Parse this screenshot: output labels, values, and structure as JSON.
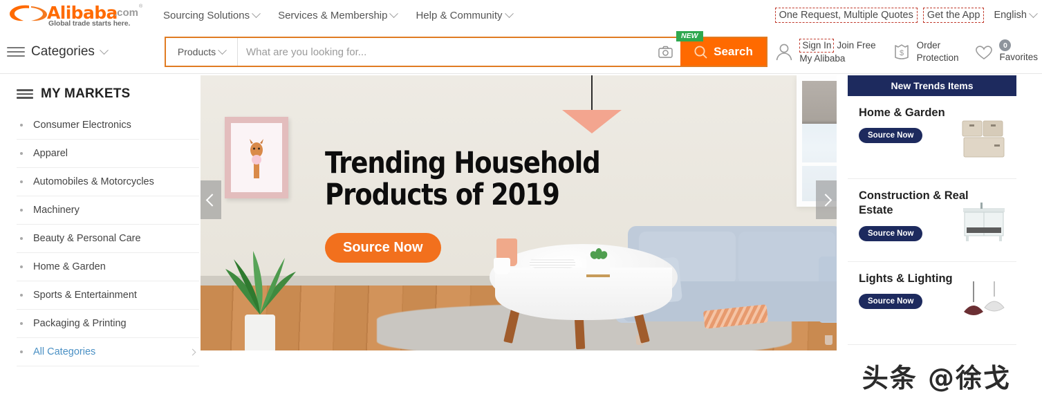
{
  "brand": {
    "logo_word": "Alibaba",
    "logo_dotcom": ".com",
    "logo_reg": "®",
    "tagline": "Global trade starts here.",
    "accent_orange": "#ff6a00",
    "navy": "#1d2a5e",
    "cta_orange": "#f2701d",
    "annotation_red": "#c0392b"
  },
  "topnav": {
    "items": [
      {
        "label": "Sourcing Solutions"
      },
      {
        "label": "Services & Membership"
      },
      {
        "label": "Help & Community"
      }
    ],
    "one_request": "One Request, Multiple Quotes",
    "get_the_app": "Get the App",
    "language": "English"
  },
  "search": {
    "categories_label": "Categories",
    "type_selector": "Products",
    "placeholder": "What are you looking for...",
    "button_label": "Search",
    "new_badge": "NEW",
    "camera_icon": "camera-icon",
    "search_icon": "magnifier-icon"
  },
  "user": {
    "sign_in": "Sign In",
    "join_free": "Join Free",
    "my_alibaba": "My Alibaba",
    "order_protection_line1": "Order",
    "order_protection_line2": "Protection",
    "favorites_label": "Favorites",
    "favorites_count": "0",
    "person_icon": "person-icon",
    "shield_icon": "order-protection-icon",
    "heart_icon": "heart-icon"
  },
  "sidebar": {
    "heading": "MY MARKETS",
    "items": [
      {
        "label": "Consumer Electronics"
      },
      {
        "label": "Apparel"
      },
      {
        "label": "Automobiles & Motorcycles"
      },
      {
        "label": "Machinery"
      },
      {
        "label": "Beauty & Personal Care"
      },
      {
        "label": "Home & Garden"
      },
      {
        "label": "Sports & Entertainment"
      },
      {
        "label": "Packaging & Printing"
      },
      {
        "label": "All Categories"
      }
    ]
  },
  "banner": {
    "title": "Trending Household\nProducts of 2019",
    "cta": "Source Now",
    "prev_icon": "chevron-left-icon",
    "next_icon": "chevron-right-icon",
    "slide_count": 2,
    "active_slide": 1
  },
  "rail": {
    "heading": "New Trends Items",
    "items": [
      {
        "title": "Home & Garden",
        "cta": "Source Now",
        "thumb": "storage-baskets-image"
      },
      {
        "title": "Construction & Real Estate",
        "cta": "Source Now",
        "thumb": "vanity-cabinet-image"
      },
      {
        "title": "Lights & Lighting",
        "cta": "Source Now",
        "thumb": "pendant-lamps-image"
      }
    ]
  },
  "watermark": {
    "text": "头条 @徐戈"
  }
}
